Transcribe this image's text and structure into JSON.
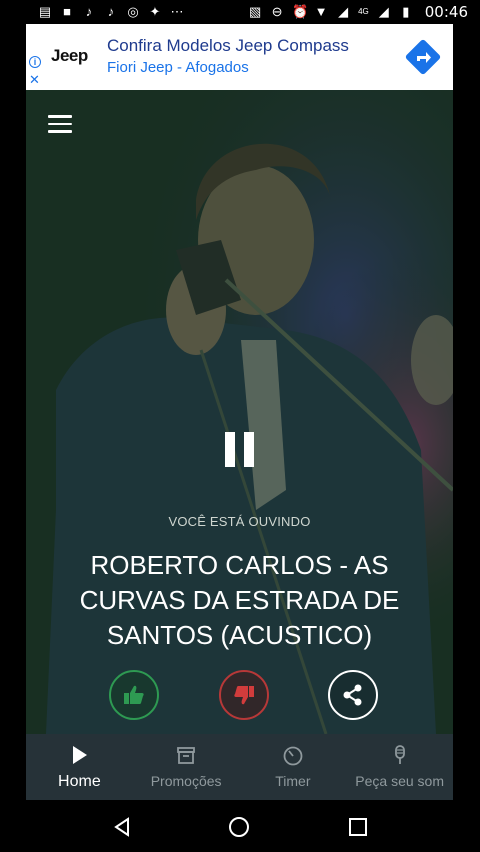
{
  "status_bar": {
    "time": "00:46",
    "network": "4G",
    "icons": [
      "notes-icon",
      "video-icon",
      "tiktok-icon",
      "tiktok-icon",
      "instagram-icon",
      "twitter-icon",
      "more-icon",
      "cast-icon",
      "dnd-icon",
      "alarm-icon",
      "wifi-icon",
      "signal-icon",
      "signal-icon",
      "battery-icon"
    ]
  },
  "ad": {
    "logo": "Jeep",
    "title": "Confira Modelos Jeep Compass",
    "subtitle": "Fiori Jeep - Afogados",
    "info_icon": "i",
    "close_icon": "✕",
    "accent_color": "#1a73e8"
  },
  "player": {
    "listening_label": "VOCÊ ESTÁ OUVINDO",
    "song_title": "ROBERTO CARLOS - AS CURVAS DA ESTRADA DE SANTOS (ACUSTICO)",
    "like_color": "#2e9a52",
    "dislike_color": "#b73838"
  },
  "bottom_nav": {
    "items": [
      {
        "label": "Home",
        "icon": "play-icon",
        "active": true
      },
      {
        "label": "Promoções",
        "icon": "archive-icon",
        "active": false
      },
      {
        "label": "Timer",
        "icon": "timer-icon",
        "active": false
      },
      {
        "label": "Peça seu som",
        "icon": "microphone-icon",
        "active": false
      }
    ]
  },
  "system_nav": {
    "buttons": [
      "back-icon",
      "home-icon",
      "recents-icon"
    ]
  }
}
